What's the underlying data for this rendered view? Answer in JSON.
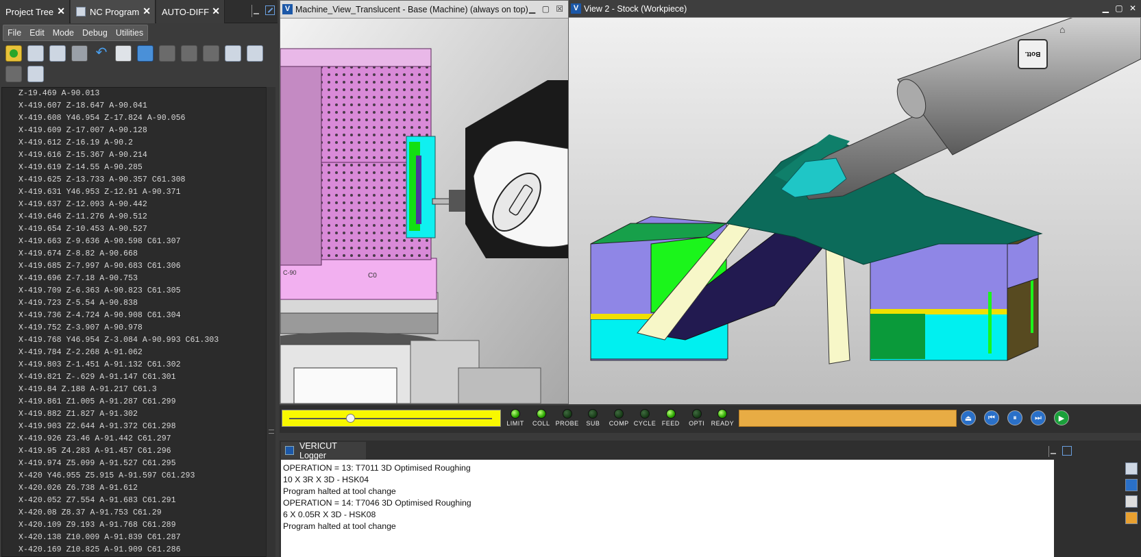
{
  "tabs": [
    {
      "label": "Project Tree"
    },
    {
      "label": "NC Program"
    },
    {
      "label": "AUTO-DIFF"
    }
  ],
  "menu": [
    "File",
    "Edit",
    "Mode",
    "Debug",
    "Utilities"
  ],
  "nc_lines": [
    "Z-19.469 A-90.013",
    "X-419.607 Z-18.647 A-90.041",
    "X-419.608 Y46.954 Z-17.824 A-90.056",
    "X-419.609 Z-17.007 A-90.128",
    "X-419.612 Z-16.19 A-90.2",
    "X-419.616 Z-15.367 A-90.214",
    "X-419.619 Z-14.55 A-90.285",
    "X-419.625 Z-13.733 A-90.357 C61.308",
    "X-419.631 Y46.953 Z-12.91 A-90.371",
    "X-419.637 Z-12.093 A-90.442",
    "X-419.646 Z-11.276 A-90.512",
    "X-419.654 Z-10.453 A-90.527",
    "X-419.663 Z-9.636 A-90.598 C61.307",
    "X-419.674 Z-8.82 A-90.668",
    "X-419.685 Z-7.997 A-90.683 C61.306",
    "X-419.696 Z-7.18 A-90.753",
    "X-419.709 Z-6.363 A-90.823 C61.305",
    "X-419.723 Z-5.54 A-90.838",
    "X-419.736 Z-4.724 A-90.908 C61.304",
    "X-419.752 Z-3.907 A-90.978",
    "X-419.768 Y46.954 Z-3.084 A-90.993 C61.303",
    "X-419.784 Z-2.268 A-91.062",
    "X-419.803 Z-1.451 A-91.132 C61.302",
    "X-419.821 Z-.629 A-91.147 C61.301",
    "X-419.84 Z.188 A-91.217 C61.3",
    "X-419.861 Z1.005 A-91.287 C61.299",
    "X-419.882 Z1.827 A-91.302",
    "X-419.903 Z2.644 A-91.372 C61.298",
    "X-419.926 Z3.46 A-91.442 C61.297",
    "X-419.95 Z4.283 A-91.457 C61.296",
    "X-419.974 Z5.099 A-91.527 C61.295",
    "X-420 Y46.955 Z5.915 A-91.597 C61.293",
    "X-420.026 Z6.738 A-91.612",
    "X-420.052 Z7.554 A-91.683 C61.291",
    "X-420.08 Z8.37 A-91.753 C61.29",
    "X-420.109 Z9.193 A-91.768 C61.289",
    "X-420.138 Z10.009 A-91.839 C61.287",
    "X-420.169 Z10.825 A-91.909 C61.286"
  ],
  "machine_view": {
    "title": "Machine_View_Translucent - Base (Machine) (always on top)",
    "label_c90": "C-90",
    "label_c0": "C0"
  },
  "stock_view": {
    "title": "View 2 - Stock (Workpiece)",
    "cube_label": "Bott."
  },
  "sim": {
    "slider_level": 0.3,
    "leds": [
      {
        "label": "LIMIT",
        "state": "on"
      },
      {
        "label": "COLL",
        "state": "on"
      },
      {
        "label": "PROBE",
        "state": "off"
      },
      {
        "label": "SUB",
        "state": "off"
      },
      {
        "label": "COMP",
        "state": "off"
      },
      {
        "label": "CYCLE",
        "state": "off"
      },
      {
        "label": "FEED",
        "state": "on"
      },
      {
        "label": "OPTI",
        "state": "off"
      },
      {
        "label": "READY",
        "state": "on"
      }
    ]
  },
  "logger": {
    "title": "VERICUT Logger",
    "lines": [
      "OPERATION = 13: T7011 3D Optimised Roughing",
      "10 X 3R X 3D - HSK04",
      "Program halted at tool change",
      "OPERATION = 14: T7046 3D Optimised Roughing",
      "6 X 0.05R X 3D - HSK08",
      "Program halted at tool change"
    ]
  },
  "colors": {
    "accent": "#1c58a8",
    "slider": "#f8f800",
    "progress": "#e8ac44",
    "part_purple": "#8f86e6",
    "part_cyan": "#00f0f0",
    "part_green": "#1bf51b",
    "part_teal": "#0c6b5a"
  }
}
